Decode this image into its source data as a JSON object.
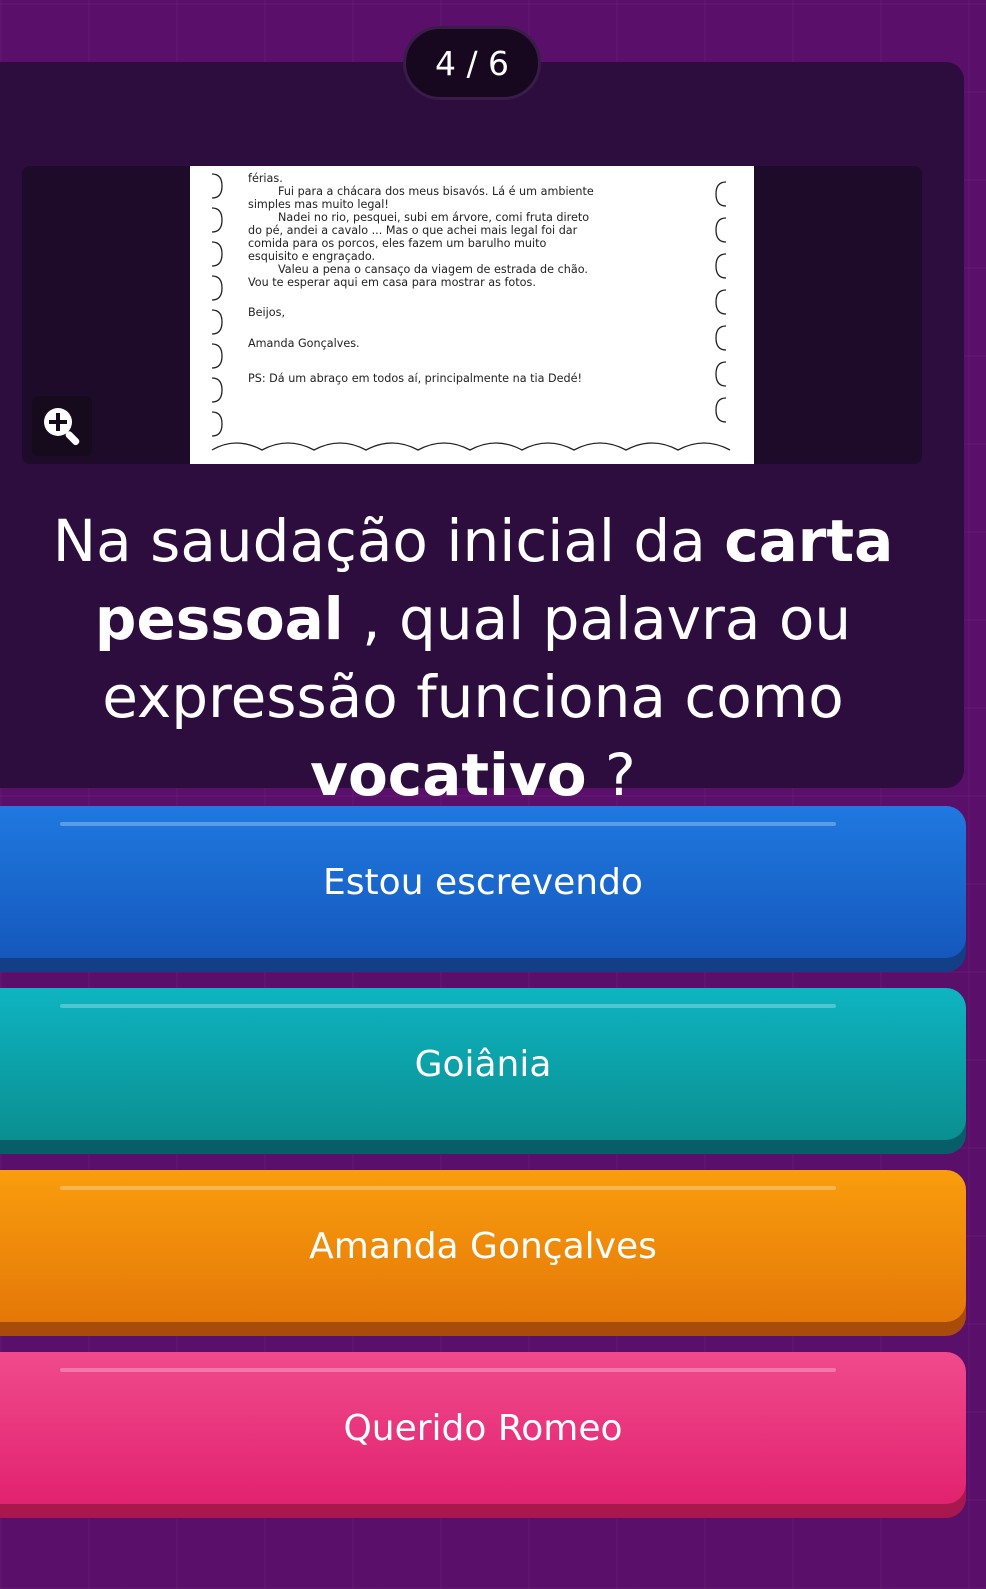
{
  "progress": {
    "label": "4 / 6"
  },
  "question_image": {
    "zoom_icon": "zoom-in-icon",
    "letter_lines": [
      "férias.",
      "Fui para a chácara dos meus bisavós. Lá é um ambiente",
      "simples mas muito legal!",
      "Nadei no rio, pesquei, subi em árvore, comi fruta direto",
      "do pé, andei a cavalo ... Mas o que achei mais legal foi dar",
      "comida para os porcos, eles fazem um barulho muito",
      "esquisito e engraçado.",
      "Valeu a pena o cansaço da viagem de estrada de chão.",
      "Vou te esperar aqui em casa para mostrar as fotos.",
      "Beijos,",
      "Amanda Gonçalves.",
      "PS: Dá um abraço em todos aí, principalmente na tia Dedé!"
    ]
  },
  "question": {
    "part1": "Na saudação inicial da ",
    "bold1": "carta pessoal",
    "part2": " , qual palavra ou expressão funciona como ",
    "bold2": "vocativo",
    "part3": " ?"
  },
  "options": [
    {
      "label": "Estou escrevendo",
      "color": "#1f79e0"
    },
    {
      "label": "Goiânia",
      "color": "#0eb4c2"
    },
    {
      "label": "Amanda Gonçalves",
      "color": "#f99d0d"
    },
    {
      "label": "Querido Romeo",
      "color": "#f04a8c"
    }
  ],
  "colors": {
    "background": "#5a0f6a",
    "card": "#2d0d3d"
  }
}
